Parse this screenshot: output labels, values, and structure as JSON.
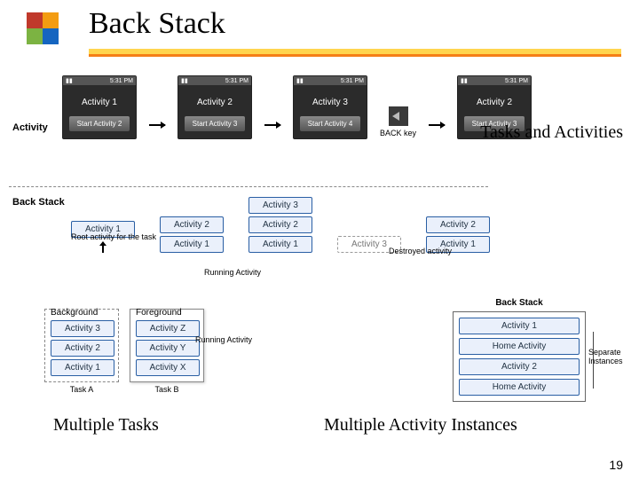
{
  "title": "Back Stack",
  "labels": {
    "tasks_activities": "Tasks and Activities",
    "multiple_tasks": "Multiple Tasks",
    "multiple_instances": "Multiple Activity Instances",
    "activity": "Activity",
    "back_stack": "Back Stack",
    "back_key": "BACK key",
    "root": "Root activity for the task",
    "running_activity": "Running Activity",
    "running_activity2": "Running Activity",
    "destroyed": "Destroyed activity",
    "background": "Background",
    "foreground": "Foreground",
    "task_a": "Task A",
    "task_b": "Task B",
    "back_stack_r": "Back Stack",
    "separate_instances": "Separate Instances"
  },
  "phone_status_time": "5:31 PM",
  "phones": [
    {
      "title": "Activity 1",
      "button": "Start Activity 2"
    },
    {
      "title": "Activity 2",
      "button": "Start Activity 3"
    },
    {
      "title": "Activity 3",
      "button": "Start Activity 4"
    },
    {
      "title": "Activity 2",
      "button": "Start Activity 3"
    }
  ],
  "stacks": [
    [
      "Activity 1"
    ],
    [
      "Activity 2",
      "Activity 1"
    ],
    [
      "Activity 3",
      "Activity 2",
      "Activity 1"
    ],
    [
      "Activity 2",
      "Activity 1"
    ]
  ],
  "ghost_box": "Activity 3",
  "mt_background": [
    "Activity 3",
    "Activity 2",
    "Activity 1"
  ],
  "mt_foreground": [
    "Activity Z",
    "Activity Y",
    "Activity X"
  ],
  "bsr_stack": [
    "Activity 1",
    "Home Activity",
    "Activity 2",
    "Home Activity"
  ],
  "page_number": "19"
}
